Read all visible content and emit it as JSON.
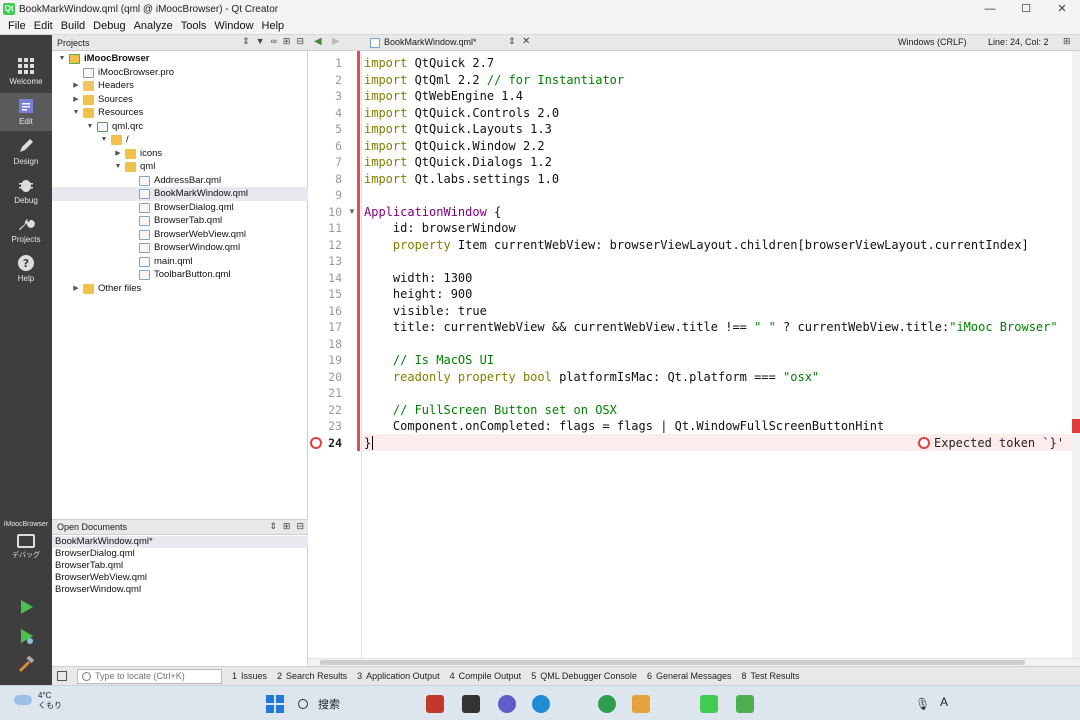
{
  "window": {
    "title": "BookMarkWindow.qml (qml @ iMoocBrowser) - Qt Creator",
    "minimize": "—",
    "maximize": "☐",
    "close": "✕"
  },
  "menu": [
    "File",
    "Edit",
    "Build",
    "Debug",
    "Analyze",
    "Tools",
    "Window",
    "Help"
  ],
  "modes": [
    {
      "label": "Welcome",
      "icon": "grid-icon"
    },
    {
      "label": "Edit",
      "icon": "edit-icon",
      "active": true
    },
    {
      "label": "Design",
      "icon": "pen-icon"
    },
    {
      "label": "Debug",
      "icon": "bug-icon"
    },
    {
      "label": "Projects",
      "icon": "wrench-icon"
    },
    {
      "label": "Help",
      "icon": "help-icon"
    }
  ],
  "kit": {
    "project": "iMoocBrowser",
    "config": "デバッグ"
  },
  "projects": {
    "header": "Projects",
    "tree": [
      {
        "label": "iMoocBrowser",
        "depth": 0,
        "arrow": "▼",
        "icon": "proj",
        "bold": true
      },
      {
        "label": "iMoocBrowser.pro",
        "depth": 1,
        "arrow": "",
        "icon": "file"
      },
      {
        "label": "Headers",
        "depth": 1,
        "arrow": "▶",
        "icon": "header"
      },
      {
        "label": "Sources",
        "depth": 1,
        "arrow": "▶",
        "icon": "src"
      },
      {
        "label": "Resources",
        "depth": 1,
        "arrow": "▼",
        "icon": "folder"
      },
      {
        "label": "qml.qrc",
        "depth": 2,
        "arrow": "▼",
        "icon": "qrc"
      },
      {
        "label": "/",
        "depth": 3,
        "arrow": "▼",
        "icon": "folder"
      },
      {
        "label": "icons",
        "depth": 4,
        "arrow": "▶",
        "icon": "folder"
      },
      {
        "label": "qml",
        "depth": 4,
        "arrow": "▼",
        "icon": "folder"
      },
      {
        "label": "AddressBar.qml",
        "depth": 5,
        "arrow": "",
        "icon": "qml"
      },
      {
        "label": "BookMarkWindow.qml",
        "depth": 5,
        "arrow": "",
        "icon": "qml",
        "selected": true
      },
      {
        "label": "BrowserDialog.qml",
        "depth": 5,
        "arrow": "",
        "icon": "qml"
      },
      {
        "label": "BrowserTab.qml",
        "depth": 5,
        "arrow": "",
        "icon": "qml"
      },
      {
        "label": "BrowserWebView.qml",
        "depth": 5,
        "arrow": "",
        "icon": "qml"
      },
      {
        "label": "BrowserWindow.qml",
        "depth": 5,
        "arrow": "",
        "icon": "qml"
      },
      {
        "label": "main.qml",
        "depth": 5,
        "arrow": "",
        "icon": "qml"
      },
      {
        "label": "ToolbarButton.qml",
        "depth": 5,
        "arrow": "",
        "icon": "qml"
      },
      {
        "label": "Other files",
        "depth": 1,
        "arrow": "▶",
        "icon": "folder"
      }
    ]
  },
  "open_documents": {
    "header": "Open Documents",
    "items": [
      {
        "label": "BookMarkWindow.qml*",
        "selected": true
      },
      {
        "label": "BrowserDialog.qml"
      },
      {
        "label": "BrowserTab.qml"
      },
      {
        "label": "BrowserWebView.qml"
      },
      {
        "label": "BrowserWindow.qml"
      }
    ]
  },
  "editor": {
    "doc_name": "BookMarkWindow.qml*",
    "encoding": "Windows (CRLF)",
    "position": "Line: 24, Col: 2",
    "diagnostic": "Expected token `}'",
    "error_line": 24,
    "lines": [
      [
        [
          "kw",
          "import"
        ],
        [
          "",
          " QtQuick 2.7"
        ]
      ],
      [
        [
          "kw",
          "import"
        ],
        [
          "",
          " QtQml 2.2 "
        ],
        [
          "cm",
          "// for Instantiator"
        ]
      ],
      [
        [
          "kw",
          "import"
        ],
        [
          "",
          " QtWebEngine 1.4"
        ]
      ],
      [
        [
          "kw",
          "import"
        ],
        [
          "",
          " QtQuick.Controls 2.0"
        ]
      ],
      [
        [
          "kw",
          "import"
        ],
        [
          "",
          " QtQuick.Layouts 1.3"
        ]
      ],
      [
        [
          "kw",
          "import"
        ],
        [
          "",
          " QtQuick.Window 2.2"
        ]
      ],
      [
        [
          "kw",
          "import"
        ],
        [
          "",
          " QtQuick.Dialogs 1.2"
        ]
      ],
      [
        [
          "kw",
          "import"
        ],
        [
          "",
          " Qt.labs.settings 1.0"
        ]
      ],
      [],
      [
        [
          "typ",
          "ApplicationWindow"
        ],
        [
          "",
          " {"
        ]
      ],
      [
        [
          "",
          "    id: browserWindow"
        ]
      ],
      [
        [
          "kw",
          "    property"
        ],
        [
          "",
          " Item currentWebView: browserViewLayout.children[browserViewLayout.currentIndex]"
        ]
      ],
      [],
      [
        [
          "",
          "    width: 1300"
        ]
      ],
      [
        [
          "",
          "    height: 900"
        ]
      ],
      [
        [
          "",
          "    visible: true"
        ]
      ],
      [
        [
          "",
          "    title: currentWebView && currentWebView.title !== "
        ],
        [
          "str",
          "\" \""
        ],
        [
          "",
          " ? currentWebView.title:"
        ],
        [
          "str",
          "\"iMooc Browser\""
        ]
      ],
      [],
      [
        [
          "cm",
          "    // Is MacOS UI"
        ]
      ],
      [
        [
          "kw",
          "    readonly property bool"
        ],
        [
          "",
          " platformIsMac: Qt.platform === "
        ],
        [
          "str",
          "\"osx\""
        ]
      ],
      [],
      [
        [
          "cm",
          "    // FullScreen Button set on OSX"
        ]
      ],
      [
        [
          "",
          "    Component.onCompleted: flags = flags | Qt.WindowFullScreenButtonHint"
        ]
      ],
      [
        [
          "",
          "}"
        ]
      ]
    ]
  },
  "status": {
    "locator_placeholder": "Type to locate (Ctrl+K)",
    "tabs": [
      {
        "n": "1",
        "label": "Issues"
      },
      {
        "n": "2",
        "label": "Search Results"
      },
      {
        "n": "3",
        "label": "Application Output"
      },
      {
        "n": "4",
        "label": "Compile Output"
      },
      {
        "n": "5",
        "label": "QML Debugger Console"
      },
      {
        "n": "6",
        "label": "General Messages"
      },
      {
        "n": "8",
        "label": "Test Results"
      }
    ]
  },
  "taskbar": {
    "temperature": "4°C",
    "condition": "くもり",
    "search": "搜索",
    "ime": "A"
  }
}
